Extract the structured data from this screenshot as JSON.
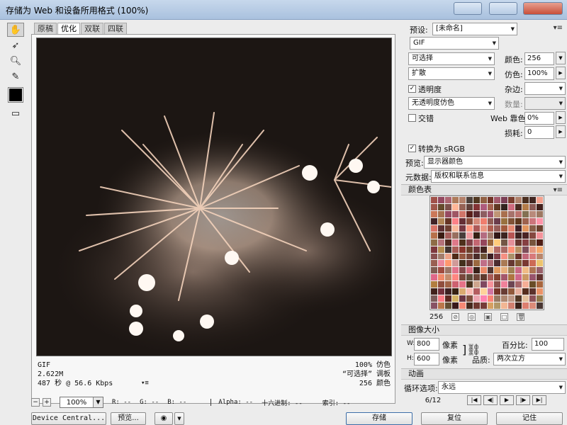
{
  "window": {
    "title": "存储为 Web 和设备所用格式 (100%)",
    "title_buttons": [
      "",
      "",
      ""
    ]
  },
  "tools": [
    "hand-tool-icon",
    "slice-select-icon",
    "zoom-icon",
    "eyedropper-icon"
  ],
  "tabs": [
    {
      "label": "原稿",
      "active": false
    },
    {
      "label": "优化",
      "active": true
    },
    {
      "label": "双联",
      "active": false
    },
    {
      "label": "四联",
      "active": false
    }
  ],
  "image_info": {
    "format": "GIF",
    "size": "2.622M",
    "time": "487 秒 @ 56.6 Kbps",
    "dither": "100% 仿色",
    "palette": "“可选择” 调板",
    "colors": "256 颜色"
  },
  "statusbar": {
    "zoom": "100%",
    "r": "R: --",
    "g": "G: --",
    "b": "B: --",
    "alpha": "Alpha: --",
    "hex": "十六进制: --",
    "index": "索引: --"
  },
  "bottom_buttons": {
    "device_central": "Device Central...",
    "preview": "预览...",
    "save": "存储",
    "reset": "复位",
    "remember": "记住"
  },
  "settings": {
    "preset_label": "预设:",
    "preset_value": "[未命名]",
    "format": "GIF",
    "reduction": "可选择",
    "dither_algo": "扩散",
    "colors_label": "颜色:",
    "colors_value": "256",
    "dither_label": "仿色:",
    "dither_value": "100%",
    "transparency_label": "透明度",
    "transparency_checked": "✓",
    "matte_label": "杂边:",
    "matte_value": "",
    "transparency_dither": "无透明度仿色",
    "amount_label": "数量:",
    "amount_value": "",
    "interlaced_label": "交错",
    "interlaced_checked": "",
    "websnap_label": "Web 靠色:",
    "websnap_value": "0%",
    "lossy_label": "损耗:",
    "lossy_value": "0",
    "srgb_label": "转换为 sRGB",
    "srgb_checked": "✓",
    "preview_label": "预览:",
    "preview_value": "显示器颜色",
    "metadata_label": "元数据:",
    "metadata_value": "版权和联系信息"
  },
  "color_table": {
    "title": "颜色表",
    "count": "256"
  },
  "image_size": {
    "title": "图像大小",
    "w_label": "W:",
    "w_value": "800",
    "h_label": "H:",
    "h_value": "600",
    "unit": "像素",
    "percent_label": "百分比:",
    "percent_value": "100",
    "quality_label": "品质:",
    "quality_value": "两次立方"
  },
  "animation": {
    "title": "动画",
    "loop_label": "循环选项:",
    "loop_value": "永远",
    "frame": "6/12"
  },
  "colors": {
    "accent": "#3c6ea8"
  }
}
